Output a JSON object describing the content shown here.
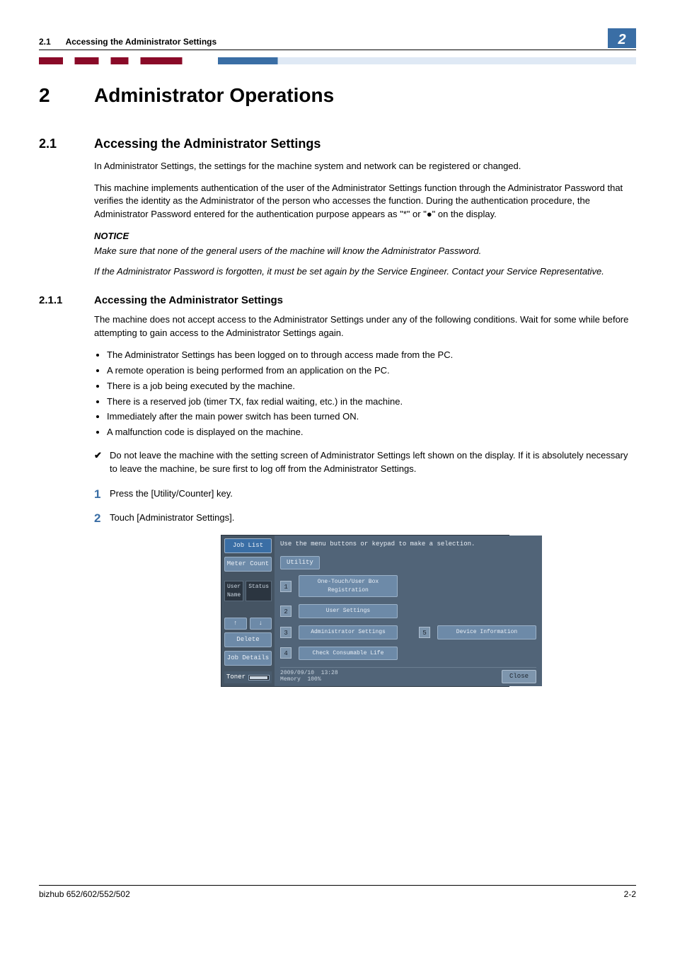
{
  "header": {
    "section_number": "2.1",
    "section_title": "Accessing the Administrator Settings",
    "chapter_number": "2"
  },
  "chapter": {
    "num": "2",
    "title": "Administrator Operations"
  },
  "sec": {
    "num": "2.1",
    "title": "Accessing the Administrator Settings",
    "p1": "In Administrator Settings, the settings for the machine system and network can be registered or changed.",
    "p2": "This machine implements authentication of the user of the Administrator Settings function through the Administrator Password that verifies the identity as the Administrator of the person who accesses the function. During the authentication procedure, the Administrator Password entered for the authentication purpose appears as \"*\" or \"●\" on the display.",
    "notice_head": "NOTICE",
    "notice1": "Make sure that none of the general users of the machine will know the Administrator Password.",
    "notice2": "If the Administrator Password is forgotten, it must be set again by the Service Engineer. Contact your Service Representative."
  },
  "subsec": {
    "num": "2.1.1",
    "title": "Accessing the Administrator Settings",
    "lead": "The machine does not accept access to the Administrator Settings under any of the following conditions. Wait for some while before attempting to gain access to the Administrator Settings again.",
    "bullets": [
      "The Administrator Settings has been logged on to through access made from the PC.",
      "A remote operation is being performed from an application on the PC.",
      "There is a job being executed by the machine.",
      "There is a reserved job (timer TX, fax redial waiting, etc.) in the machine.",
      "Immediately after the main power switch has been turned ON.",
      "A malfunction code is displayed on the machine."
    ],
    "check": "Do not leave the machine with the setting screen of Administrator Settings left shown on the display. If it is absolutely necessary to leave the machine, be sure first to log off from the Administrator Settings.",
    "steps": [
      "Press the [Utility/Counter] key.",
      "Touch [Administrator Settings]."
    ]
  },
  "panel": {
    "left": {
      "job_list": "Job List",
      "meter_count": "Meter Count",
      "user_hdr": "User Name",
      "status_hdr": "Status",
      "delete": "Delete",
      "job_details": "Job Details",
      "toner_label": "Toner"
    },
    "right": {
      "prompt": "Use the menu buttons or keypad to make a selection.",
      "crumb": "Utility",
      "items": [
        {
          "n": "1",
          "label": "One-Touch/User Box Registration"
        },
        {
          "n": "2",
          "label": "User Settings"
        },
        {
          "n": "3",
          "label": "Administrator Settings"
        },
        {
          "n": "4",
          "label": "Check Consumable Life"
        }
      ],
      "item5": {
        "n": "5",
        "label": "Device Information"
      },
      "date": "2009/09/10",
      "time": "13:28",
      "mem_label": "Memory",
      "mem_val": "100%",
      "close": "Close"
    }
  },
  "footer": {
    "left": "bizhub 652/602/552/502",
    "right": "2-2"
  }
}
